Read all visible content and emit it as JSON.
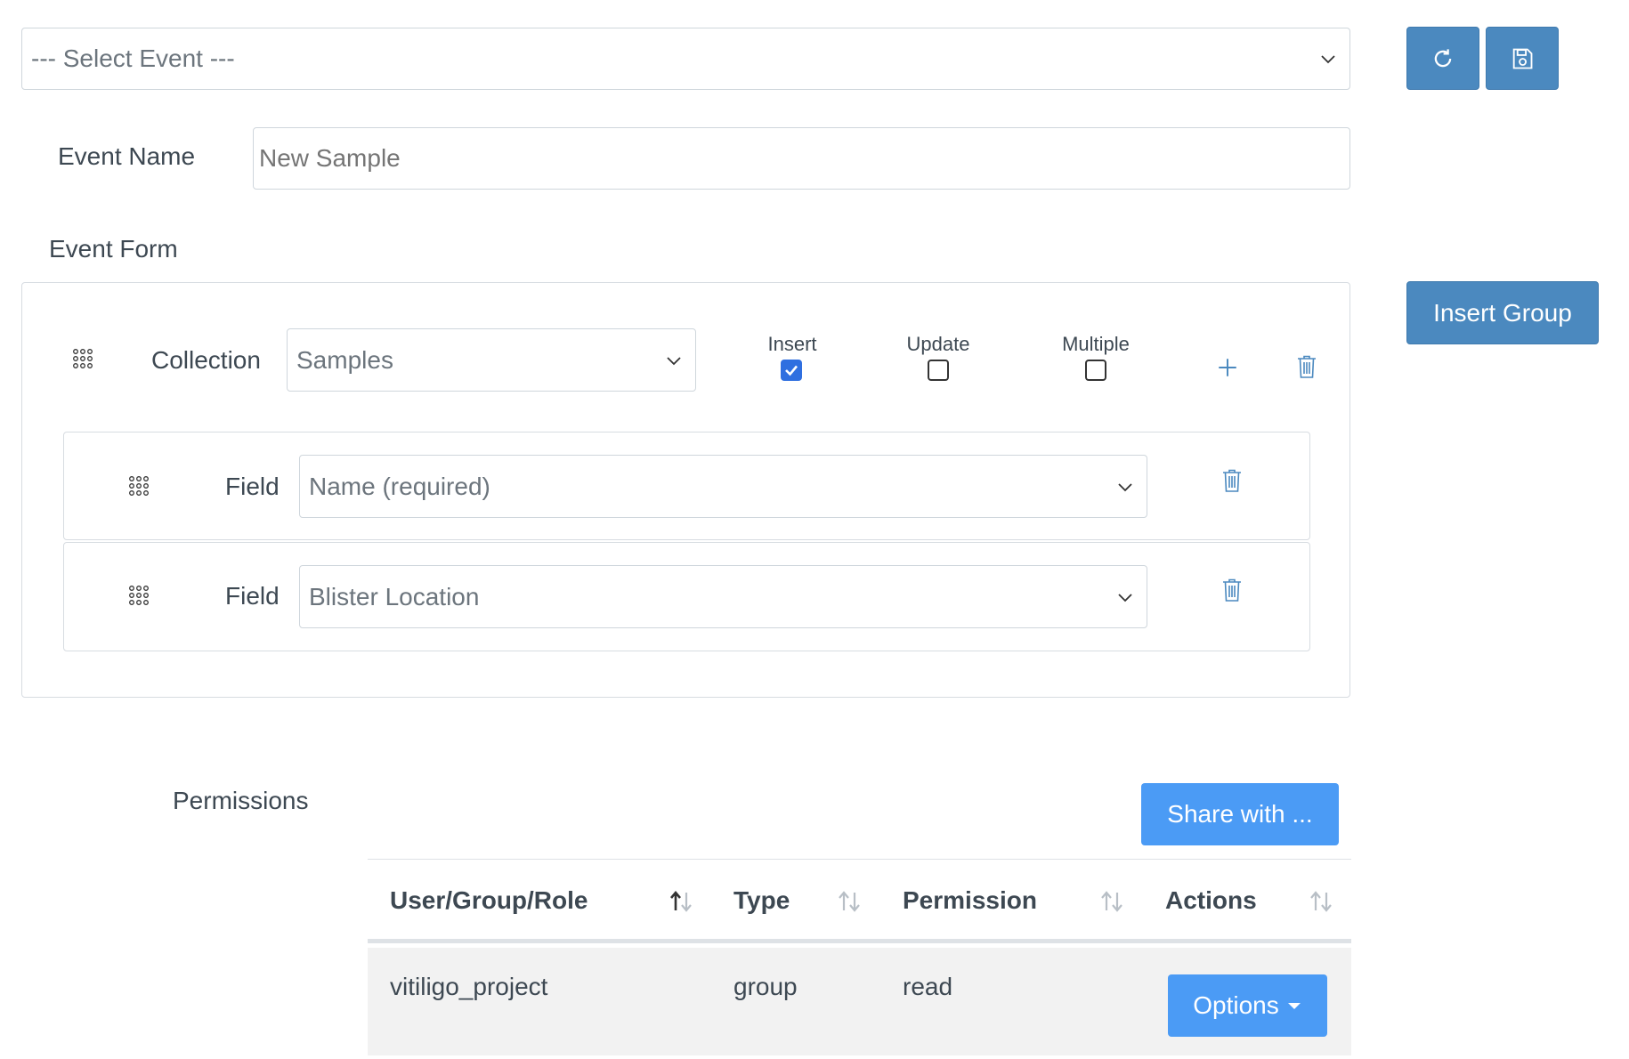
{
  "event_select": {
    "value": "--- Select Event ---"
  },
  "top_buttons": {
    "refresh_icon": "refresh-icon",
    "save_icon": "floppy-disk-icon"
  },
  "event_name": {
    "label": "Event Name",
    "placeholder": "New Sample",
    "value": ""
  },
  "event_form": {
    "label": "Event Form"
  },
  "insert_group_button": {
    "label": "Insert Group"
  },
  "collection": {
    "label": "Collection",
    "value": "Samples",
    "checkboxes": [
      {
        "label": "Insert",
        "checked": true
      },
      {
        "label": "Update",
        "checked": false
      },
      {
        "label": "Multiple",
        "checked": false
      }
    ]
  },
  "fields": [
    {
      "label": "Field",
      "value": "Name (required)"
    },
    {
      "label": "Field",
      "value": "Blister Location"
    }
  ],
  "permissions": {
    "label": "Permissions",
    "share_button": "Share with ...",
    "columns": [
      "User/Group/Role",
      "Type",
      "Permission",
      "Actions"
    ],
    "rows": [
      {
        "name": "vitiligo_project",
        "type": "group",
        "permission": "read",
        "action": "Options"
      }
    ]
  },
  "colors": {
    "steel_button": "#4b89bf",
    "primary_button": "#4b9bf5",
    "icon_blue": "#4b89bf",
    "checkbox_checked": "#2f6fe0",
    "row_bg": "#f2f2f2"
  }
}
